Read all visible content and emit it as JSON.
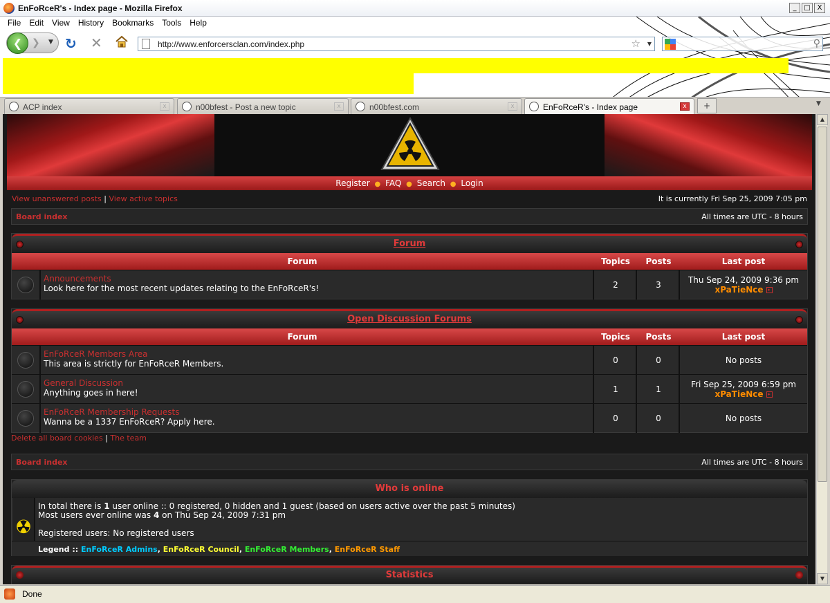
{
  "window": {
    "title": "EnFoRceR's - Index page - Mozilla Firefox",
    "controls": [
      "_",
      "□",
      "X"
    ]
  },
  "menu": [
    "File",
    "Edit",
    "View",
    "History",
    "Bookmarks",
    "Tools",
    "Help"
  ],
  "nav": {
    "url": "http://www.enforcersclan.com/index.php"
  },
  "tabs": [
    {
      "label": "ACP index",
      "active": false
    },
    {
      "label": "n00bfest - Post a new topic",
      "active": false
    },
    {
      "label": "n00bfest.com",
      "active": false
    },
    {
      "label": "EnFoRceR's - Index page",
      "active": true
    }
  ],
  "status": {
    "text": "Done"
  },
  "forum": {
    "header_links": {
      "register": "Register",
      "faq": "FAQ",
      "search": "Search",
      "login": "Login"
    },
    "topline": {
      "unanswered": "View unanswered posts",
      "separator": "|",
      "active": "View active topics",
      "current_time": "It is currently Fri Sep 25, 2009 7:05 pm"
    },
    "breadcrumb": {
      "board_index": "Board index",
      "timezone": "All times are UTC - 8 hours"
    },
    "columns": {
      "forum": "Forum",
      "topics": "Topics",
      "posts": "Posts",
      "last_post": "Last post"
    },
    "categories": [
      {
        "title": "Forum",
        "forums": [
          {
            "name": "Announcements",
            "desc": "Look here for the most recent updates relating to the EnFoRceR's!",
            "topics": "2",
            "posts": "3",
            "last_post_date": "Thu Sep 24, 2009 9:36 pm",
            "last_post_user": "xPaTieNce"
          }
        ]
      },
      {
        "title": "Open Discussion Forums",
        "forums": [
          {
            "name": "EnFoRceR Members Area",
            "desc": "This area is strictly for EnFoRceR Members.",
            "topics": "0",
            "posts": "0",
            "last_post_date": "No posts",
            "last_post_user": ""
          },
          {
            "name": "General Discussion",
            "desc": "Anything goes in here!",
            "topics": "1",
            "posts": "1",
            "last_post_date": "Fri Sep 25, 2009 6:59 pm",
            "last_post_user": "xPaTieNce"
          },
          {
            "name": "EnFoRceR Membership Requests",
            "desc": "Wanna be a 1337 EnFoRceR? Apply here.",
            "topics": "0",
            "posts": "0",
            "last_post_date": "No posts",
            "last_post_user": ""
          }
        ]
      }
    ],
    "bottom_links": {
      "delete_cookies": "Delete all board cookies",
      "separator": "|",
      "team": "The team"
    },
    "who_online": {
      "title": "Who is online",
      "line1_a": "In total there is ",
      "line1_b": "1",
      "line1_c": " user online :: 0 registered, 0 hidden and 1 guest (based on users active over the past 5 minutes)",
      "line2_a": "Most users ever online was ",
      "line2_b": "4",
      "line2_c": " on Thu Sep 24, 2009 7:31 pm",
      "registered": "Registered users: No registered users",
      "legend_label": "Legend ::",
      "legend": [
        {
          "name": "EnFoRceR Admins",
          "color": "#00ccff"
        },
        {
          "name": "EnFoRceR Council",
          "color": "#ffff33"
        },
        {
          "name": "EnFoRceR Members",
          "color": "#33ee33"
        },
        {
          "name": "EnFoRceR Staff",
          "color": "#ff9900"
        }
      ]
    },
    "statistics": {
      "title": "Statistics"
    }
  },
  "colors": {
    "accent_red": "#c83030",
    "last_post_user": "#ff8c00",
    "bar_red": "#a01c1c"
  }
}
